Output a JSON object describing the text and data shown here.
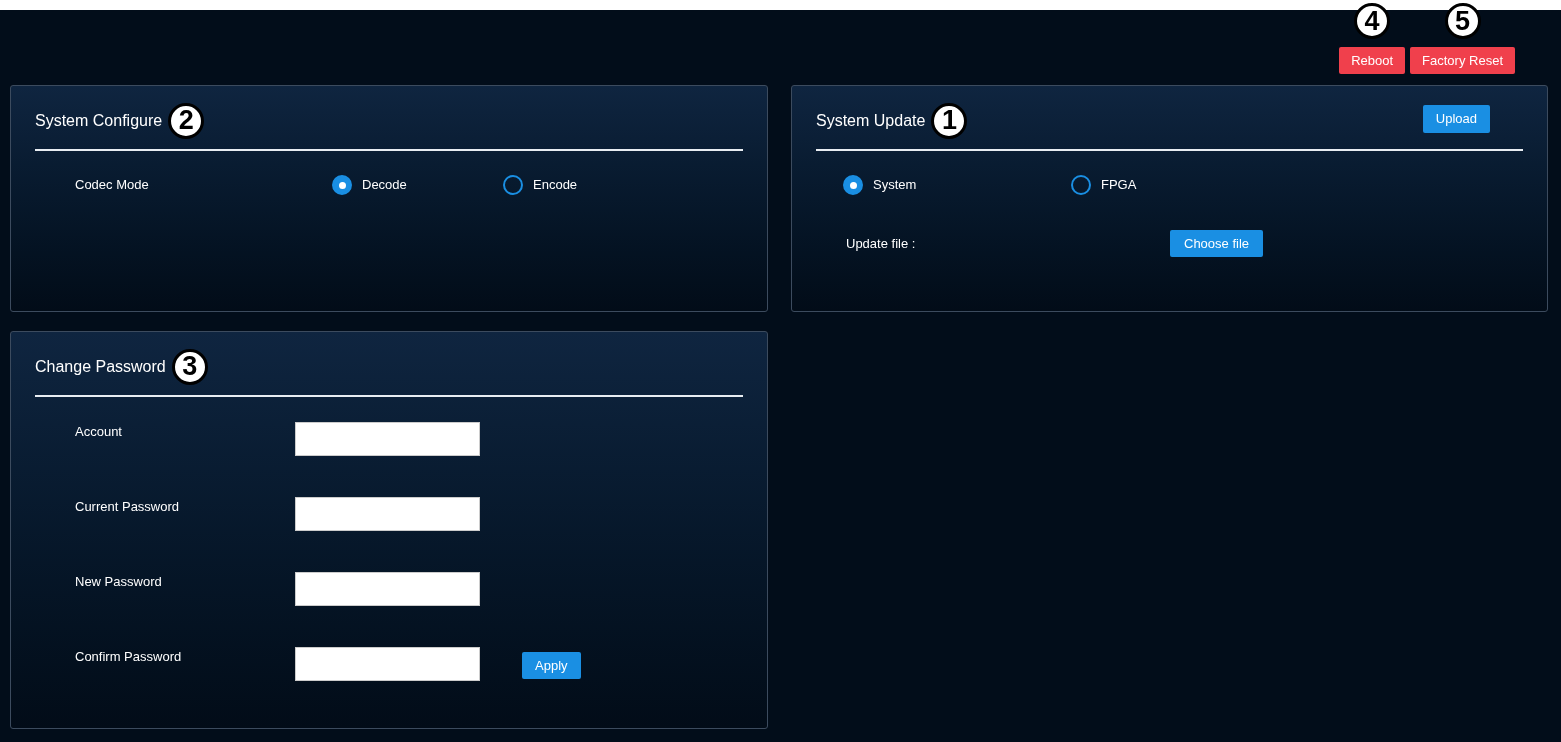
{
  "header": {
    "buttons": [
      {
        "label": "Reboot",
        "callout": "4"
      },
      {
        "label": "Factory Reset",
        "callout": "5"
      }
    ]
  },
  "system_configure": {
    "title": "System Configure",
    "callout": "2",
    "codec_mode": {
      "label": "Codec Mode",
      "options": [
        {
          "label": "Decode",
          "selected": true
        },
        {
          "label": "Encode",
          "selected": false
        }
      ]
    }
  },
  "system_update": {
    "title": "System Update",
    "callout": "1",
    "upload_button": "Upload",
    "targets": [
      {
        "label": "System",
        "selected": true
      },
      {
        "label": "FPGA",
        "selected": false
      }
    ],
    "update_file": {
      "label": "Update file :",
      "button": "Choose file"
    }
  },
  "change_password": {
    "title": "Change Password",
    "callout": "3",
    "fields": [
      {
        "label": "Account"
      },
      {
        "label": "Current Password"
      },
      {
        "label": "New Password"
      },
      {
        "label": "Confirm Password"
      }
    ],
    "apply_button": "Apply"
  }
}
